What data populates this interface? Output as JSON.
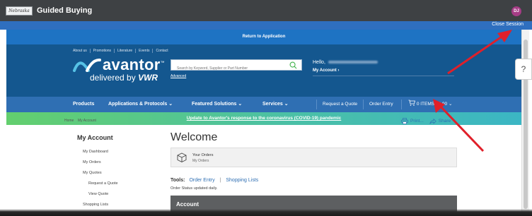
{
  "guided_buying": {
    "logo_text": "Nebraska",
    "title": "Guided Buying",
    "avatar_initials": "DJ",
    "close_session": "Close Session"
  },
  "return_bar": {
    "label": "Return to Application"
  },
  "header": {
    "util_links": [
      "About us",
      "Promotions",
      "Literature",
      "Events",
      "Contact"
    ],
    "logo_main": "avantor",
    "logo_tm": "™",
    "logo_sub_prefix": "delivered by",
    "logo_sub_brand": "VWR",
    "search_placeholder": "Search by Keyword, Supplier or Part Number",
    "advanced_label": "Advanced",
    "hello_label": "Hello,",
    "my_account_label": "My Account",
    "my_account_chevron": "›"
  },
  "nav": {
    "items": [
      {
        "label": "Products"
      },
      {
        "label": "Applications & Protocols"
      },
      {
        "label": "Featured Solutions"
      },
      {
        "label": "Services"
      },
      {
        "label": "Request a Quote"
      },
      {
        "label": "Order Entry"
      },
      {
        "label": "0  ITEMS $0.00"
      }
    ],
    "chevron": "⌄"
  },
  "banner": {
    "label": "Update to Avantor's response to the coronavirus (COVID-19) pandemic"
  },
  "breadcrumb": {
    "home": "Home",
    "sep": "›",
    "current": "My Account"
  },
  "actions": {
    "print": "Print...",
    "share": "Share"
  },
  "sidebar": {
    "title": "My Account",
    "items": [
      {
        "label": "My Dashboard",
        "level": 1
      },
      {
        "label": "My Orders",
        "level": 1
      },
      {
        "label": "My Quotes",
        "level": 1
      },
      {
        "label": "Request a Quote",
        "level": 2
      },
      {
        "label": "View Quote",
        "level": 2
      },
      {
        "label": "Shopping Lists",
        "level": 1
      }
    ]
  },
  "main": {
    "welcome": "Welcome",
    "orders_card": {
      "title": "Your Orders",
      "subtitle": "My Orders"
    },
    "tools_label": "Tools:",
    "tools_links": [
      "Order Entry",
      "Shopping Lists"
    ],
    "tools_sep": "|",
    "status_line": "Order Status updated daily.",
    "account_heading": "Account"
  },
  "help_badge": "?",
  "colors": {
    "gb_bar": "#3e4144",
    "session_bar": "#2f6fbf",
    "header": "#14578f",
    "nav": "#2f6fb3",
    "accent_arrow": "#e0202a",
    "avatar": "#a63d86"
  }
}
